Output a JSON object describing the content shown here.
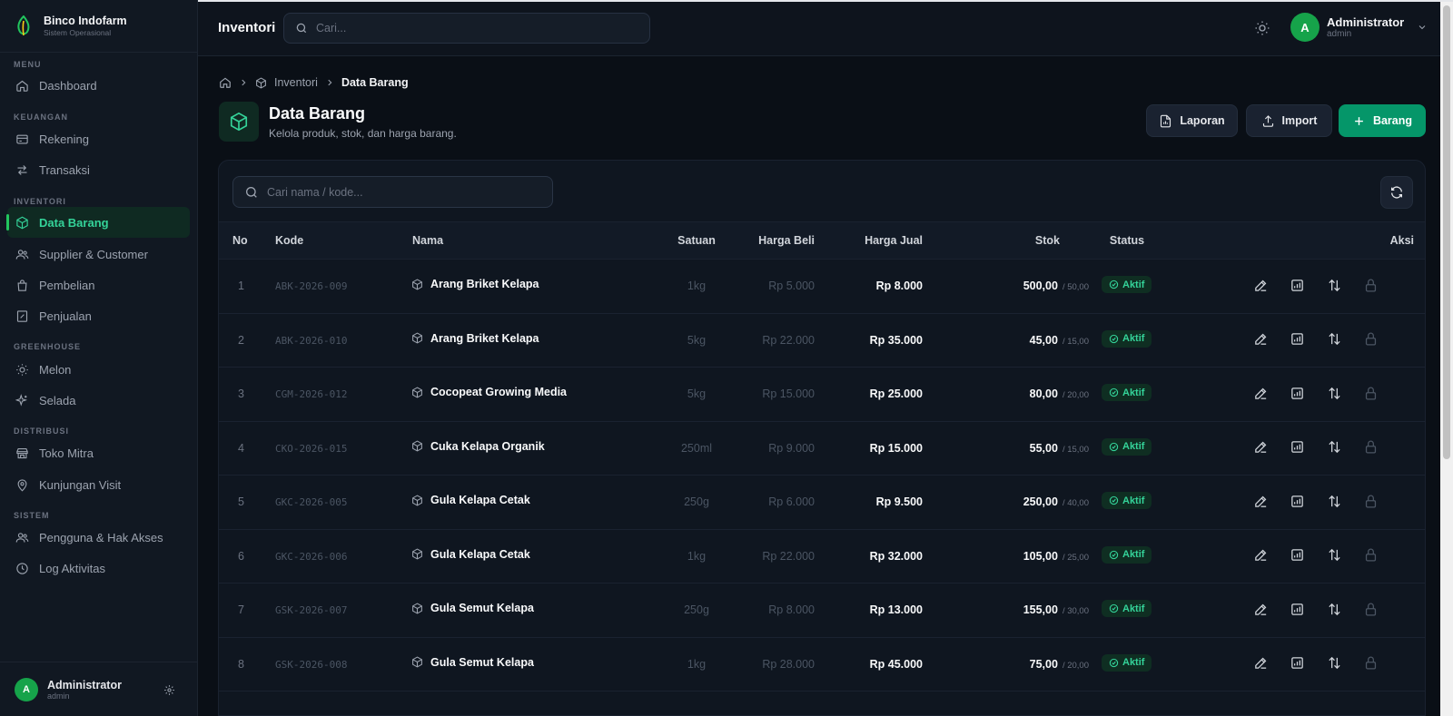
{
  "brand": {
    "name": "Binco Indofarm",
    "subtitle": "Sistem Operasional"
  },
  "sidebar": {
    "sections": [
      {
        "label": "MENU",
        "items": [
          {
            "label": "Dashboard",
            "icon": "home-icon"
          }
        ]
      },
      {
        "label": "KEUANGAN",
        "items": [
          {
            "label": "Rekening",
            "icon": "card-icon"
          },
          {
            "label": "Transaksi",
            "icon": "arrows-swap-icon"
          }
        ]
      },
      {
        "label": "INVENTORI",
        "items": [
          {
            "label": "Data Barang",
            "icon": "box-icon",
            "active": true
          },
          {
            "label": "Supplier & Customer",
            "icon": "users-icon"
          },
          {
            "label": "Pembelian",
            "icon": "bag-icon"
          },
          {
            "label": "Penjualan",
            "icon": "receipt-icon"
          }
        ]
      },
      {
        "label": "GREENHOUSE",
        "items": [
          {
            "label": "Melon",
            "icon": "sun-icon"
          },
          {
            "label": "Selada",
            "icon": "sparkles-icon"
          }
        ]
      },
      {
        "label": "DISTRIBUSI",
        "items": [
          {
            "label": "Toko Mitra",
            "icon": "store-icon"
          },
          {
            "label": "Kunjungan Visit",
            "icon": "map-pin-icon"
          }
        ]
      },
      {
        "label": "SISTEM",
        "items": [
          {
            "label": "Pengguna & Hak Akses",
            "icon": "users-icon"
          },
          {
            "label": "Log Aktivitas",
            "icon": "clock-icon"
          }
        ]
      }
    ],
    "user": {
      "initial": "A",
      "name": "Administrator",
      "role": "admin"
    }
  },
  "topbar": {
    "title": "Inventori",
    "search_placeholder": "Cari...",
    "user": {
      "initial": "A",
      "name": "Administrator",
      "role": "admin"
    }
  },
  "breadcrumb": {
    "parent": "Inventori",
    "current": "Data Barang"
  },
  "page": {
    "title": "Data Barang",
    "subtitle": "Kelola produk, stok, dan harga barang."
  },
  "actions": {
    "report": "Laporan",
    "import": "Import",
    "add": "Barang"
  },
  "table": {
    "search_placeholder": "Cari nama / kode...",
    "headers": {
      "no": "No",
      "kode": "Kode",
      "nama": "Nama",
      "satuan": "Satuan",
      "harga_beli": "Harga Beli",
      "harga_jual": "Harga Jual",
      "stok": "Stok",
      "status": "Status",
      "aksi": "Aksi"
    },
    "rows": [
      {
        "no": "1",
        "kode": "ABK-2026-009",
        "nama": "Arang Briket Kelapa",
        "satuan": "1kg",
        "harga_beli": "Rp 5.000",
        "harga_jual": "Rp 8.000",
        "stok": "500,00",
        "stok_min": "/ 50,00",
        "status": "Aktif"
      },
      {
        "no": "2",
        "kode": "ABK-2026-010",
        "nama": "Arang Briket Kelapa",
        "satuan": "5kg",
        "harga_beli": "Rp 22.000",
        "harga_jual": "Rp 35.000",
        "stok": "45,00",
        "stok_min": "/ 15,00",
        "status": "Aktif"
      },
      {
        "no": "3",
        "kode": "CGM-2026-012",
        "nama": "Cocopeat Growing Media",
        "satuan": "5kg",
        "harga_beli": "Rp 15.000",
        "harga_jual": "Rp 25.000",
        "stok": "80,00",
        "stok_min": "/ 20,00",
        "status": "Aktif"
      },
      {
        "no": "4",
        "kode": "CKO-2026-015",
        "nama": "Cuka Kelapa Organik",
        "satuan": "250ml",
        "harga_beli": "Rp 9.000",
        "harga_jual": "Rp 15.000",
        "stok": "55,00",
        "stok_min": "/ 15,00",
        "status": "Aktif"
      },
      {
        "no": "5",
        "kode": "GKC-2026-005",
        "nama": "Gula Kelapa Cetak",
        "satuan": "250g",
        "harga_beli": "Rp 6.000",
        "harga_jual": "Rp 9.500",
        "stok": "250,00",
        "stok_min": "/ 40,00",
        "status": "Aktif"
      },
      {
        "no": "6",
        "kode": "GKC-2026-006",
        "nama": "Gula Kelapa Cetak",
        "satuan": "1kg",
        "harga_beli": "Rp 22.000",
        "harga_jual": "Rp 32.000",
        "stok": "105,00",
        "stok_min": "/ 25,00",
        "status": "Aktif"
      },
      {
        "no": "7",
        "kode": "GSK-2026-007",
        "nama": "Gula Semut Kelapa",
        "satuan": "250g",
        "harga_beli": "Rp 8.000",
        "harga_jual": "Rp 13.000",
        "stok": "155,00",
        "stok_min": "/ 30,00",
        "status": "Aktif"
      },
      {
        "no": "8",
        "kode": "GSK-2026-008",
        "nama": "Gula Semut Kelapa",
        "satuan": "1kg",
        "harga_beli": "Rp 28.000",
        "harga_jual": "Rp 45.000",
        "stok": "75,00",
        "stok_min": "/ 20,00",
        "status": "Aktif"
      }
    ]
  },
  "colors": {
    "accent": "#059669",
    "active_text": "#34d399",
    "background": "#0a0f16"
  }
}
